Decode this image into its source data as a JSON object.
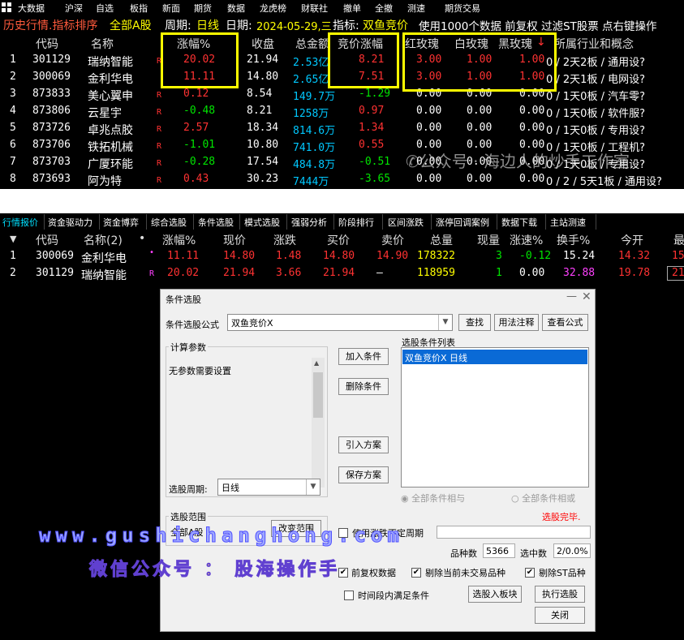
{
  "menu": [
    "大数据",
    "沪深",
    "自选",
    "板指",
    "新面",
    "期货",
    "数据",
    "龙虎榜",
    "财联社",
    "撤单",
    "全撤",
    "测速",
    "期货交易"
  ],
  "infobar": {
    "mode": "历史行情.指标排序",
    "market": "全部A股",
    "period_label": "周期:",
    "period": "日线",
    "date_label": "日期:",
    "date": "2024-05-29,三",
    "indicator_label": "指标:",
    "indicator": "双鱼竞价",
    "extra": "使用1000个数据 前复权 过滤ST股票 点右键操作"
  },
  "table1": {
    "headers": [
      "代码",
      "名称",
      "涨幅%",
      "收盘",
      "总金额",
      "竞价涨幅",
      "红玫瑰",
      "白玫瑰",
      "黑玫瑰",
      "所属行业和概念"
    ],
    "rows": [
      {
        "n": "1",
        "code": "301129",
        "name": "瑞纳智能",
        "flag": "R",
        "chg": "20.02",
        "close": "21.94",
        "amt": "2.53亿",
        "bid": "8.21",
        "red": "3.00",
        "white": "1.00",
        "black": "1.00",
        "ind": "0 / 2天2板 / 通用设?"
      },
      {
        "n": "2",
        "code": "300069",
        "name": "金利华电",
        "flag": "",
        "chg": "11.11",
        "close": "14.80",
        "amt": "2.65亿",
        "bid": "7.51",
        "red": "3.00",
        "white": "1.00",
        "black": "1.00",
        "ind": "0 / 2天1板 / 电网设?"
      },
      {
        "n": "3",
        "code": "873833",
        "name": "美心翼申",
        "flag": "R",
        "chg": "0.12",
        "close": "8.54",
        "amt": "149.7万",
        "bid": "-1.29",
        "red": "0.00",
        "white": "0.00",
        "black": "0.00",
        "ind": "0 / 1天0板 / 汽车零?"
      },
      {
        "n": "4",
        "code": "873806",
        "name": "云星宇",
        "flag": "R",
        "chg": "-0.48",
        "close": "8.21",
        "amt": "1258万",
        "bid": "0.97",
        "red": "0.00",
        "white": "0.00",
        "black": "0.00",
        "ind": "0 / 1天0板 / 软件服?"
      },
      {
        "n": "5",
        "code": "873726",
        "name": "卓兆点胶",
        "flag": "R",
        "chg": "2.57",
        "close": "18.34",
        "amt": "814.6万",
        "bid": "1.34",
        "red": "0.00",
        "white": "0.00",
        "black": "0.00",
        "ind": "0 / 1天0板 / 专用设?"
      },
      {
        "n": "6",
        "code": "873706",
        "name": "铁拓机械",
        "flag": "R",
        "chg": "-1.01",
        "close": "10.80",
        "amt": "741.0万",
        "bid": "0.55",
        "red": "0.00",
        "white": "0.00",
        "black": "0.00",
        "ind": "0 / 1天0板 / 工程机?"
      },
      {
        "n": "7",
        "code": "873703",
        "name": "广厦环能",
        "flag": "R",
        "chg": "-0.28",
        "close": "17.54",
        "amt": "484.8万",
        "bid": "-0.51",
        "red": "0.00",
        "white": "0.00",
        "black": "0.00",
        "ind": "0 / 1天0板 / 专用设?"
      },
      {
        "n": "8",
        "code": "873693",
        "name": "阿为特",
        "flag": "R",
        "chg": "0.43",
        "close": "30.23",
        "amt": "7444万",
        "bid": "-3.65",
        "red": "0.00",
        "white": "0.00",
        "black": "0.00",
        "ind": "0 / 2 / 5天1板 / 通用设?"
      }
    ]
  },
  "watermark_top": "公众号 · 海边人的炒手工作室",
  "tabs": [
    "行情报价",
    "资金驱动力",
    "资金博弈",
    "综合选股",
    "条件选股",
    "模式选股",
    "强弱分析",
    "阶段排行",
    "区间涨跌",
    "涨停回调案例",
    "数据下载",
    "主站测速"
  ],
  "table2": {
    "headers": [
      "代码",
      "名称(2)",
      "•",
      "涨幅%",
      "现价",
      "涨跌",
      "买价",
      "卖价",
      "总量",
      "现量",
      "涨速%",
      "换手%",
      "今开",
      "最"
    ],
    "rows": [
      {
        "n": "1",
        "code": "300069",
        "name": "金利华电",
        "mark": "•",
        "chg": "11.11",
        "price": "14.80",
        "diff": "1.48",
        "buy": "14.80",
        "sell": "14.90",
        "vol": "178322",
        "cur": "3",
        "speed": "-0.12",
        "turn": "15.24",
        "open": "14.32",
        "last": "15"
      },
      {
        "n": "2",
        "code": "301129",
        "name": "瑞纳智能",
        "mark": "R",
        "chg": "20.02",
        "price": "21.94",
        "diff": "3.66",
        "buy": "21.94",
        "sell": "–",
        "vol": "118959",
        "cur": "1",
        "speed": "0.00",
        "turn": "32.88",
        "open": "19.78",
        "last": "21"
      }
    ]
  },
  "dialog": {
    "title": "条件选股",
    "formula_label": "条件选股公式",
    "formula_value": "双鱼竞价X",
    "find": "查找",
    "usage": "用法注释",
    "view": "查看公式",
    "params_label": "计算参数",
    "params_text": "无参数需要设置",
    "add": "加入条件",
    "delete": "删除条件",
    "import": "引入方案",
    "save": "保存方案",
    "list_label": "选股条件列表",
    "list_items": [
      "双鱼竞价X  日线"
    ],
    "radio_and": "全部条件相与",
    "radio_or": "全部条件相或",
    "status": "选股完毕.",
    "period_label": "选股周期:",
    "period_value": "日线",
    "range_label": "选股范围",
    "range_value": "全部A股",
    "range_btn": "改变范围",
    "use_uncertain": "使用涨跌不定周期",
    "count_label": "品种数",
    "count_value": "5366",
    "selected_label": "选中数",
    "selected_value": "2/0.0%",
    "chk_prerights": "前复权数据",
    "chk_untraded": "剔除当前未交易品种",
    "chk_st": "剔除ST品种",
    "chk_timerange": "时间段内满足条件",
    "to_block": "选股入板块",
    "run": "执行选股",
    "close": "关闭"
  },
  "watermark1": "www.gushichanghong.com",
  "watermark2": "微信公众号 ： 股海操作手"
}
